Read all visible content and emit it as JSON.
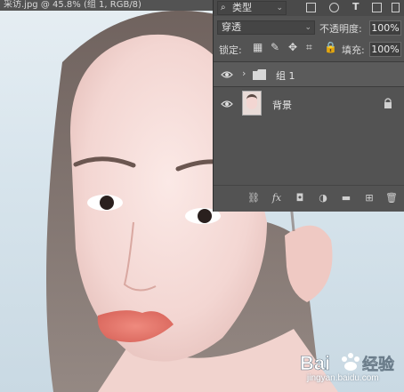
{
  "document": {
    "tab_title": "采访.jpg @ 45.8% (组 1, RGB/8)"
  },
  "layers_panel": {
    "filter_kind": "类型",
    "blend_mode": "穿透",
    "opacity_label": "不透明度:",
    "opacity_value": "100%",
    "lock_label": "锁定:",
    "fill_label": "填充:",
    "fill_value": "100%",
    "layers": [
      {
        "name": "组 1",
        "type": "group",
        "visible": true
      },
      {
        "name": "背景",
        "type": "image",
        "visible": true,
        "locked": true
      }
    ]
  },
  "watermark": {
    "brand": "Bai",
    "brand_cn": "经验",
    "url": "jingyan.baidu.com"
  },
  "colors": {
    "panel_bg": "#535353",
    "panel_border": "#2f2f2f",
    "selected_row": "#5b5b5b"
  }
}
